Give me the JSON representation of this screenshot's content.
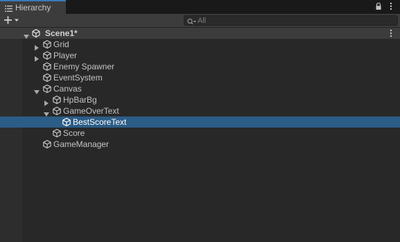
{
  "window": {
    "tab_label": "Hierarchy",
    "tab_icon": "list-icon",
    "lock_icon": "lock-icon",
    "more_icon": "kebab-menu-icon"
  },
  "toolbar": {
    "add_icon": "plus-dropdown-icon",
    "search": {
      "placeholder": "All",
      "value": "",
      "icon": "search-filter-icon"
    }
  },
  "hierarchy": {
    "scene": {
      "name": "Scene1*",
      "expanded": true,
      "icon": "unity-logo-icon"
    },
    "items": [
      {
        "name": "Grid",
        "depth": 1,
        "has_children": true,
        "expanded": false,
        "selected": false
      },
      {
        "name": "Player",
        "depth": 1,
        "has_children": true,
        "expanded": false,
        "selected": false
      },
      {
        "name": "Enemy Spawner",
        "depth": 1,
        "has_children": false,
        "expanded": false,
        "selected": false
      },
      {
        "name": "EventSystem",
        "depth": 1,
        "has_children": false,
        "expanded": false,
        "selected": false
      },
      {
        "name": "Canvas",
        "depth": 1,
        "has_children": true,
        "expanded": true,
        "selected": false
      },
      {
        "name": "HpBarBg",
        "depth": 2,
        "has_children": true,
        "expanded": false,
        "selected": false
      },
      {
        "name": "GameOverText",
        "depth": 2,
        "has_children": true,
        "expanded": true,
        "selected": false
      },
      {
        "name": "BestScoreText",
        "depth": 3,
        "has_children": false,
        "expanded": false,
        "selected": true
      },
      {
        "name": "Score",
        "depth": 2,
        "has_children": false,
        "expanded": false,
        "selected": false
      },
      {
        "name": "GameManager",
        "depth": 1,
        "has_children": false,
        "expanded": false,
        "selected": false
      }
    ]
  },
  "colors": {
    "background": "#282828",
    "header_bar": "#3c3c3c",
    "selection": "#2c5d87",
    "tab_accent": "#3a79bb",
    "text": "#c4c4c4"
  }
}
